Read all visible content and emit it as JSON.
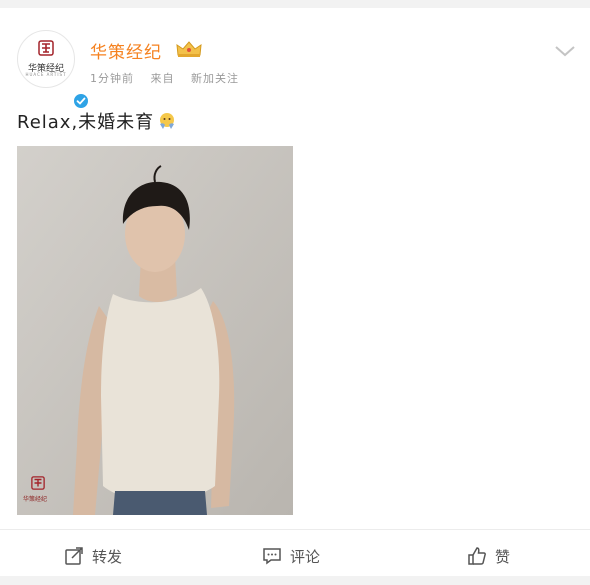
{
  "post": {
    "username": "华策经纪",
    "meta": {
      "time": "1分钟前",
      "source": "来自",
      "follow": "新加关注"
    },
    "text": "Relax,未婚未育",
    "avatar_text": "华策经纪",
    "avatar_subtext": "HUACE ARTIST",
    "photo_logo_text": "华策经纪"
  },
  "actions": {
    "repost_label": "转发",
    "comment_label": "评论",
    "like_label": "赞"
  },
  "colors": {
    "username": "#f58220",
    "verified": "#2ea3e6",
    "brand_red": "#a3232a"
  },
  "icons": [
    "brand-logo-icon",
    "verified-icon",
    "crown-icon",
    "chevron-down-icon",
    "emoji-icon",
    "repost-icon",
    "comment-icon",
    "like-icon"
  ]
}
